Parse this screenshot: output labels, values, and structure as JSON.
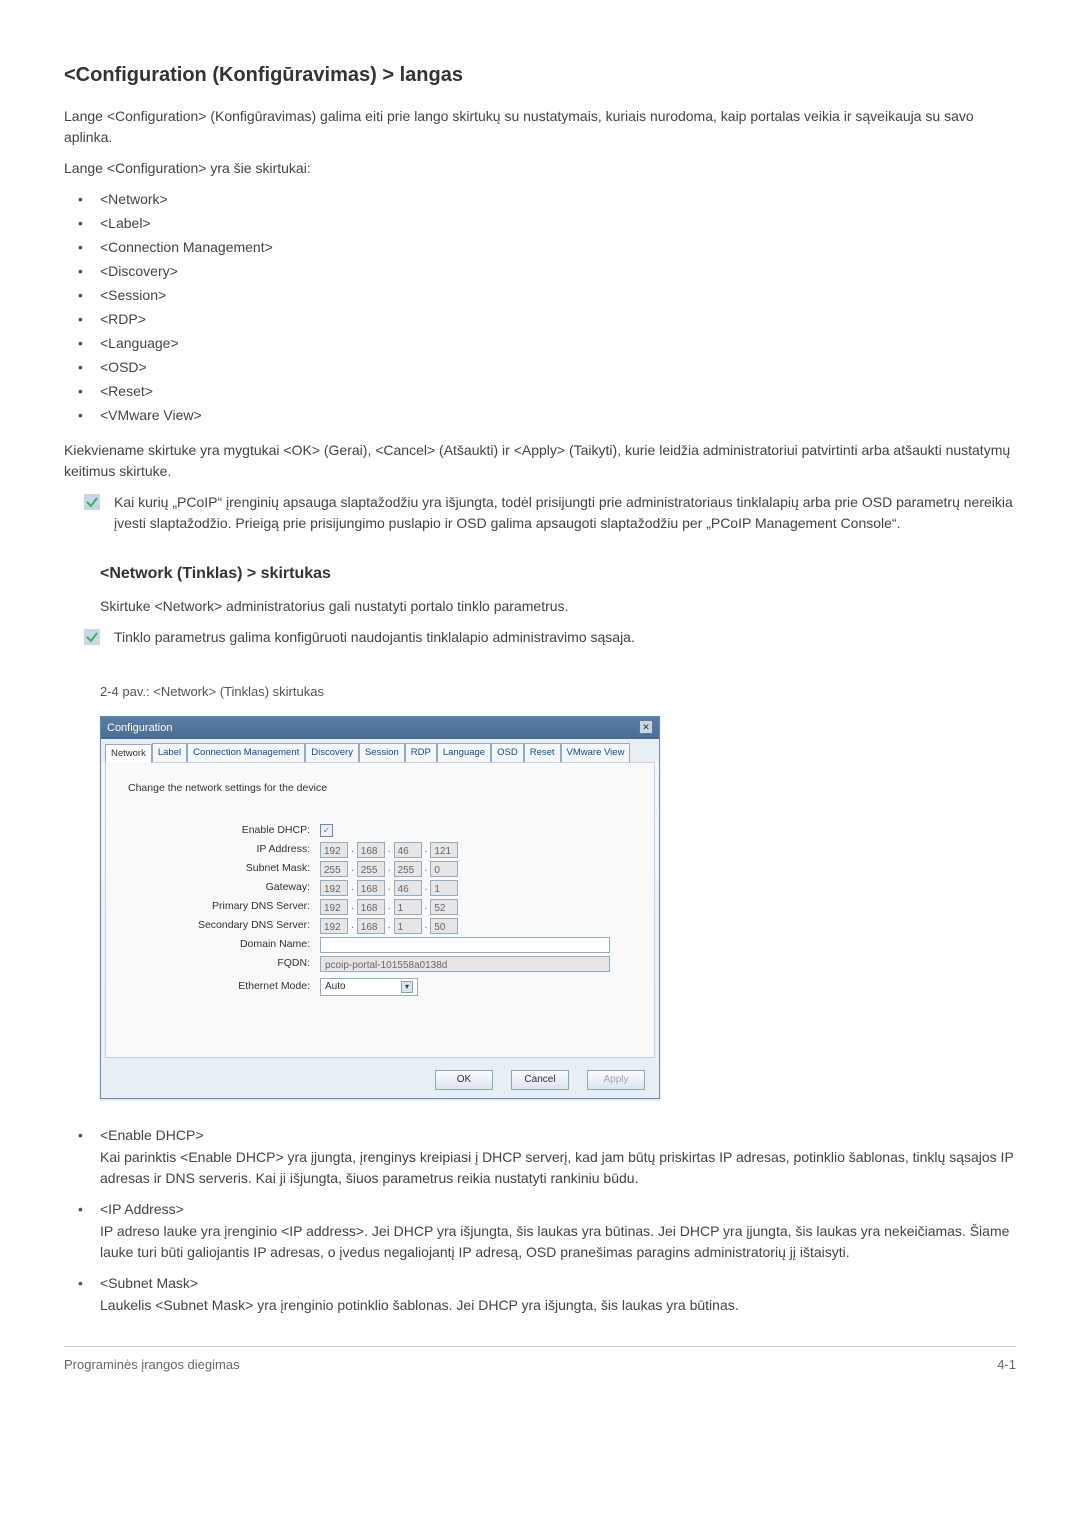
{
  "page_title": "<Configuration (Konfigūravimas) > langas",
  "intro_p1": "Lange <Configuration> (Konfigūravimas) galima eiti prie lango skirtukų su nustatymais, kuriais nurodoma, kaip portalas veikia ir sąveikauja su savo aplinka.",
  "intro_p2": "Lange <Configuration> yra šie skirtukai:",
  "config_tabs_list": [
    "<Network>",
    "<Label>",
    "<Connection Management>",
    "<Discovery>",
    "<Session>",
    "<RDP>",
    "<Language>",
    "<OSD>",
    "<Reset>",
    "<VMware View>"
  ],
  "after_list_para": "Kiekviename skirtuke yra mygtukai <OK> (Gerai), <Cancel> (Atšaukti) ir <Apply> (Taikyti), kurie leidžia administratoriui patvirtinti arba atšaukti nustatymų keitimus skirtuke.",
  "note1": "Kai kurių „PCoIP“ įrenginių apsauga slaptažodžiu yra išjungta, todėl prisijungti prie administratoriaus tinklalapių arba prie OSD parametrų nereikia įvesti slaptažodžio. Prieigą prie prisijungimo puslapio ir OSD galima apsaugoti slaptažodžiu per „PCoIP Management Console“.",
  "section_net_heading": "<Network (Tinklas) > skirtukas",
  "section_net_p1": "Skirtuke <Network> administratorius gali nustatyti portalo tinklo parametrus.",
  "note2": "Tinklo parametrus galima konfigūruoti naudojantis tinklalapio administravimo sąsaja.",
  "fig_caption": "2-4 pav.: <Network> (Tinklas) skirtukas",
  "dialog": {
    "title": "Configuration",
    "tabs": [
      "Network",
      "Label",
      "Connection Management",
      "Discovery",
      "Session",
      "RDP",
      "Language",
      "OSD",
      "Reset",
      "VMware View"
    ],
    "desc": "Change the network settings for the device",
    "labels": {
      "enable_dhcp": "Enable DHCP:",
      "ip_address": "IP Address:",
      "subnet_mask": "Subnet Mask:",
      "gateway": "Gateway:",
      "primary_dns": "Primary DNS Server:",
      "secondary_dns": "Secondary DNS Server:",
      "domain_name": "Domain Name:",
      "fqdn": "FQDN:",
      "ethernet_mode": "Ethernet Mode:"
    },
    "values": {
      "enable_dhcp_checked": "✓",
      "ip_address": [
        "192",
        "168",
        "46",
        "121"
      ],
      "subnet_mask": [
        "255",
        "255",
        "255",
        "0"
      ],
      "gateway": [
        "192",
        "168",
        "46",
        "1"
      ],
      "primary_dns": [
        "192",
        "168",
        "1",
        "52"
      ],
      "secondary_dns": [
        "192",
        "168",
        "1",
        "50"
      ],
      "domain_name": "",
      "fqdn": "pcoip-portal-101558a0138d",
      "ethernet_mode": "Auto"
    },
    "buttons": {
      "ok": "OK",
      "cancel": "Cancel",
      "apply": "Apply"
    }
  },
  "definitions": [
    {
      "term": "<Enable DHCP>",
      "body": "Kai parinktis <Enable DHCP> yra įjungta, įrenginys kreipiasi į DHCP serverį, kad jam būtų priskirtas IP adresas, potinklio šablonas, tinklų sąsajos IP adresas ir DNS serveris. Kai ji išjungta, šiuos parametrus reikia nustatyti rankiniu būdu."
    },
    {
      "term": "<IP Address>",
      "body": "IP adreso lauke yra įrenginio <IP address>. Jei DHCP yra išjungta, šis laukas yra būtinas. Jei DHCP yra įjungta, šis laukas yra nekeičiamas. Šiame lauke turi būti galiojantis IP adresas, o įvedus negaliojantį IP adresą, OSD pranešimas paragins administratorių jį ištaisyti."
    },
    {
      "term": "<Subnet Mask>",
      "body": "Laukelis <Subnet Mask> yra įrenginio potinklio šablonas. Jei DHCP yra išjungta, šis laukas yra būtinas."
    }
  ],
  "footer_left": "Programinės įrangos diegimas",
  "footer_right": "4-1"
}
